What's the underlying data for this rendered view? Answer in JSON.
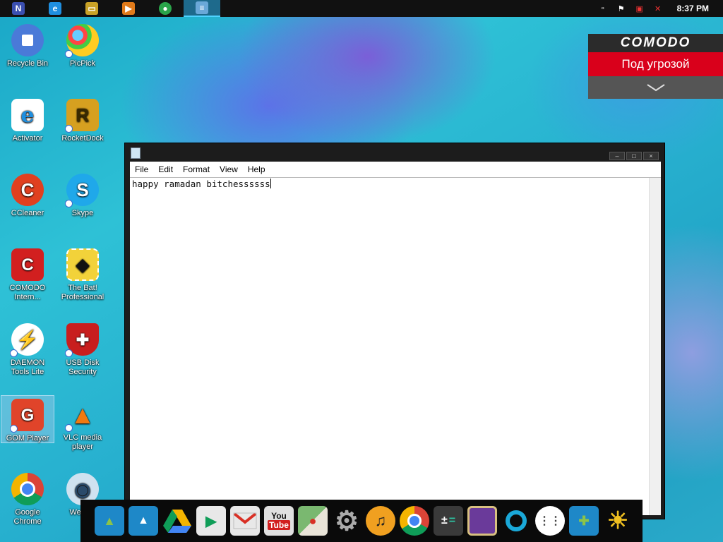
{
  "taskbar": {
    "apps": [
      {
        "name": "launcher",
        "icon": "n-logo-icon",
        "glyph": "N",
        "color": "#3b4fb0"
      },
      {
        "name": "ie",
        "icon": "internet-explorer-icon",
        "glyph": "e",
        "color": "#1f8fe0"
      },
      {
        "name": "explorer",
        "icon": "folder-icon",
        "glyph": "▭",
        "color": "#c9a227"
      },
      {
        "name": "player",
        "icon": "media-player-icon",
        "glyph": "▶",
        "color": "#e07a1a"
      },
      {
        "name": "chrome",
        "icon": "chrome-icon",
        "glyph": "●",
        "color": "#2aa44a"
      },
      {
        "name": "notepad",
        "icon": "notepad-icon",
        "glyph": "≡",
        "color": "#6aa8d8"
      }
    ],
    "tray": [
      {
        "name": "show-desktop",
        "glyph": "▫"
      },
      {
        "name": "flag",
        "glyph": "⚑"
      },
      {
        "name": "network",
        "glyph": "▣"
      },
      {
        "name": "volume-muted",
        "glyph": "✕"
      }
    ],
    "clock": "8:37 PM"
  },
  "desktop": {
    "icons": [
      {
        "label": "Recycle Bin",
        "icon": "recycle-bin-icon",
        "color": "#4a7ad8",
        "glyph": "■"
      },
      {
        "label": "PicPick",
        "icon": "picpick-icon",
        "color": "#f0c020",
        "glyph": "●"
      },
      {
        "label": "Activator",
        "icon": "internet-explorer-icon",
        "color": "#ffffff",
        "glyph": "e"
      },
      {
        "label": "RocketDock",
        "icon": "rocketdock-icon",
        "color": "#d6a020",
        "glyph": "R"
      },
      {
        "label": "CCleaner",
        "icon": "ccleaner-icon",
        "color": "#e04020",
        "glyph": "C"
      },
      {
        "label": "Skype",
        "icon": "skype-icon",
        "color": "#1fa8ea",
        "glyph": "S"
      },
      {
        "label": "COMODO Intern...",
        "icon": "comodo-icon",
        "color": "#d21f1f",
        "glyph": "C"
      },
      {
        "label": "The Bat! Professional",
        "icon": "the-bat-icon",
        "color": "#f2d23a",
        "glyph": "◆"
      },
      {
        "label": "DAEMON Tools Lite",
        "icon": "daemon-tools-icon",
        "color": "#ffffff",
        "glyph": "⚡"
      },
      {
        "label": "USB Disk Security",
        "icon": "usb-disk-security-icon",
        "color": "#c81e1e",
        "glyph": "✚"
      },
      {
        "label": "GOM Player",
        "icon": "gom-player-icon",
        "color": "#e0442a",
        "glyph": "G"
      },
      {
        "label": "VLC media player",
        "icon": "vlc-icon",
        "color": "#f07a10",
        "glyph": "▲"
      },
      {
        "label": "Google Chrome",
        "icon": "chrome-icon",
        "color": "#2aa44a",
        "glyph": "●"
      },
      {
        "label": "Webc...",
        "icon": "webcam-icon",
        "color": "#7fb0d8",
        "glyph": "◉"
      }
    ]
  },
  "comodo": {
    "brand": "COMODO",
    "status": "Под угрозой",
    "expand_glyph": "⌄"
  },
  "notepad": {
    "menu": [
      "File",
      "Edit",
      "Format",
      "View",
      "Help"
    ],
    "content": "happy ramadan bitchessssss",
    "controls": {
      "minimize": "–",
      "maximize": "□",
      "close": "×"
    }
  },
  "dock": {
    "items": [
      {
        "name": "files",
        "icon": "folder-icon",
        "color": "#1e88c8"
      },
      {
        "name": "drive-folder",
        "icon": "folder-drive-icon",
        "color": "#1e88c8"
      },
      {
        "name": "google-drive",
        "icon": "google-drive-icon",
        "color": "#2a9d4a"
      },
      {
        "name": "play-store",
        "icon": "play-store-icon",
        "color": "#e8e8e8"
      },
      {
        "name": "gmail",
        "icon": "gmail-icon",
        "color": "#e8e8e8"
      },
      {
        "name": "youtube",
        "icon": "youtube-icon",
        "color": "#e0e0e0"
      },
      {
        "name": "maps",
        "icon": "maps-icon",
        "color": "#7ab870"
      },
      {
        "name": "settings",
        "icon": "gear-icon",
        "color": "#9a9a9a"
      },
      {
        "name": "music",
        "icon": "headphones-icon",
        "color": "#f0a020"
      },
      {
        "name": "chrome",
        "icon": "chrome-icon",
        "color": "#2aa44a"
      },
      {
        "name": "calculator",
        "icon": "calculator-icon",
        "color": "#3a3a3a"
      },
      {
        "name": "gallery",
        "icon": "gallery-icon",
        "color": "#8a5ab8"
      },
      {
        "name": "hangouts",
        "icon": "chat-icon",
        "color": "#1aa8d8"
      },
      {
        "name": "apps",
        "icon": "app-drawer-icon",
        "color": "#ffffff"
      },
      {
        "name": "games-folder",
        "icon": "games-folder-icon",
        "color": "#1e88c8"
      },
      {
        "name": "weather",
        "icon": "weather-icon",
        "color": "#f0c020"
      }
    ]
  }
}
